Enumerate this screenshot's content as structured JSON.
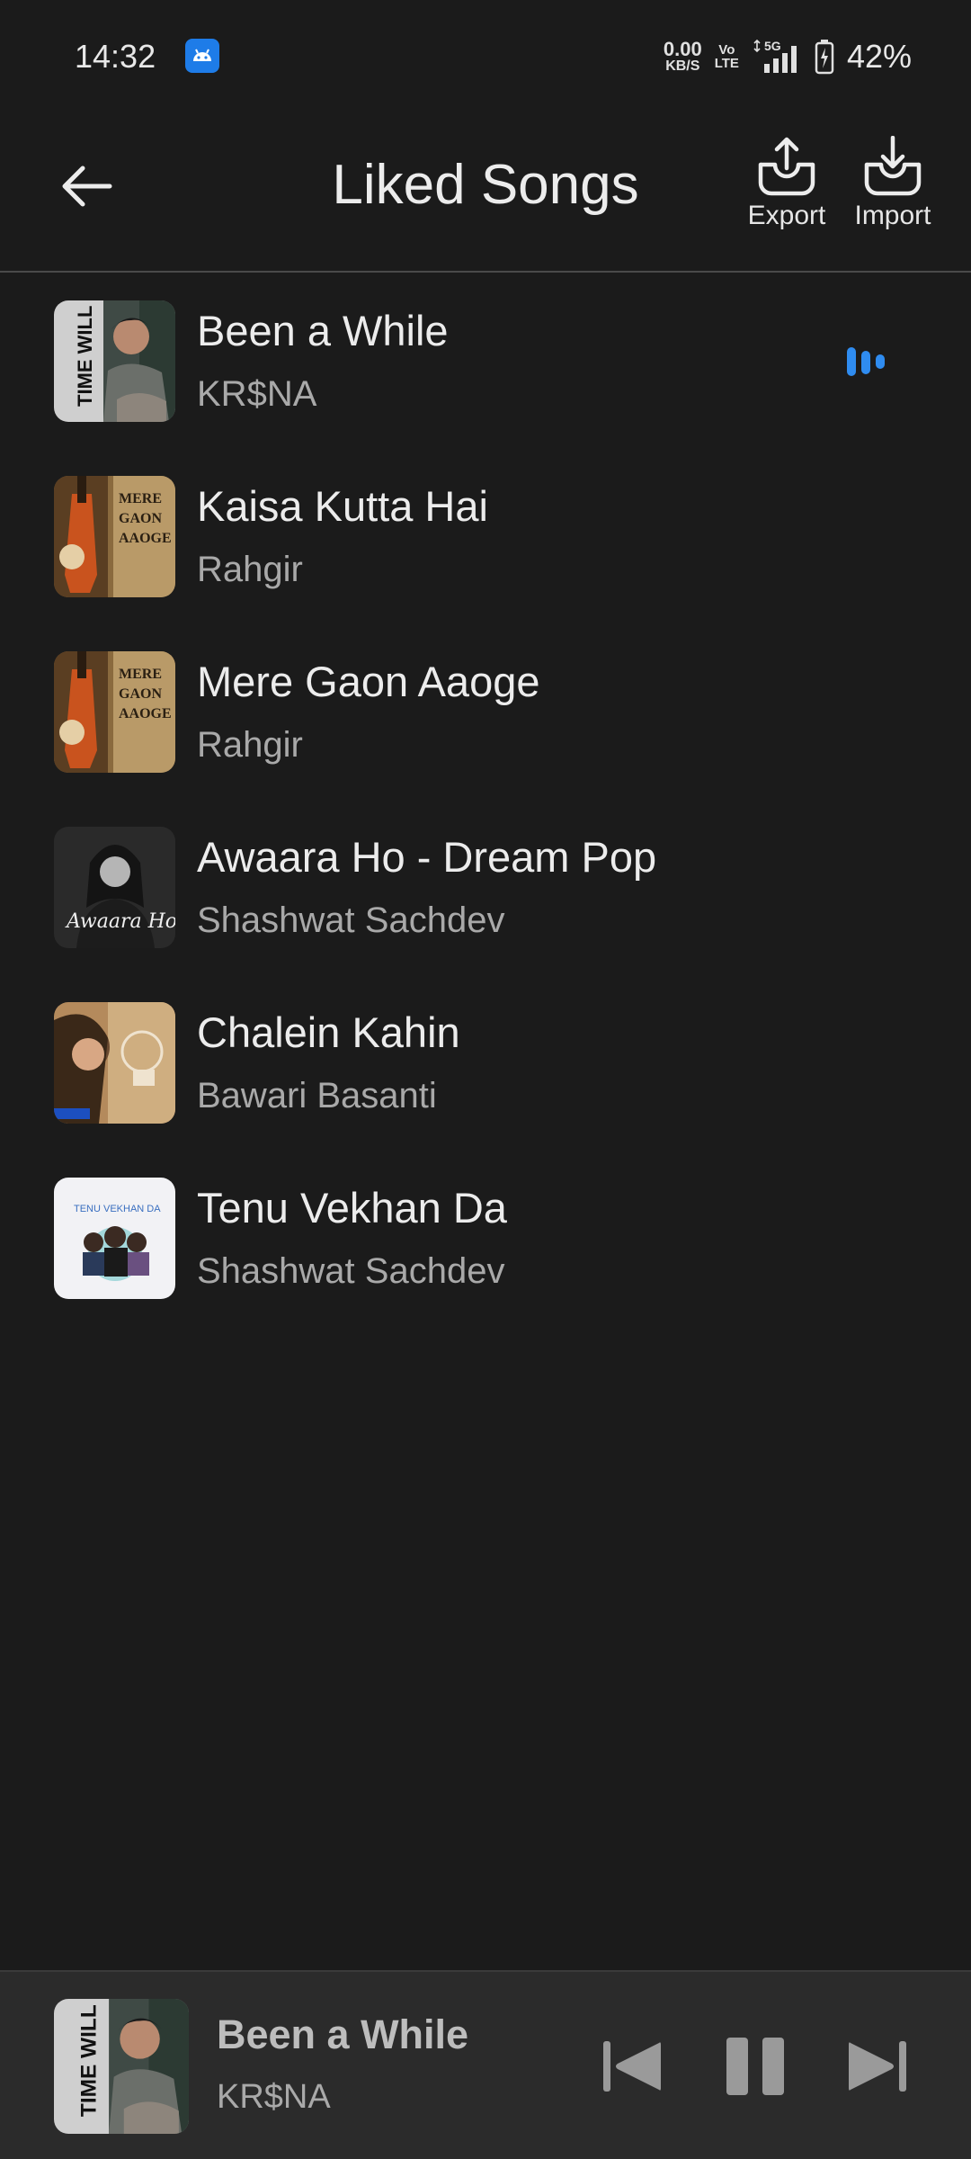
{
  "status_bar": {
    "time": "14:32",
    "net_speed_value": "0.00",
    "net_speed_unit": "KB/S",
    "volte_top": "Vo",
    "volte_bottom": "LTE",
    "network": "5G",
    "battery_percent": "42%",
    "icons": [
      "android-notification-icon",
      "signal-icon",
      "battery-icon"
    ]
  },
  "header": {
    "title": "Liked Songs",
    "export_label": "Export",
    "import_label": "Import",
    "icons": [
      "back-arrow-icon",
      "export-icon",
      "import-icon"
    ]
  },
  "songs": [
    {
      "title": "Been a While",
      "artist": "KR$NA",
      "playing": true
    },
    {
      "title": "Kaisa Kutta Hai",
      "artist": "Rahgir",
      "playing": false
    },
    {
      "title": "Mere Gaon Aaoge",
      "artist": "Rahgir",
      "playing": false
    },
    {
      "title": "Awaara Ho - Dream Pop",
      "artist": "Shashwat Sachdev",
      "playing": false
    },
    {
      "title": "Chalein Kahin",
      "artist": "Bawari Basanti",
      "playing": false
    },
    {
      "title": "Tenu Vekhan Da",
      "artist": "Shashwat Sachdev",
      "playing": false
    }
  ],
  "album_art_text": {
    "time_will_tell": "TIME WILL TELL",
    "mere_gaon": [
      "MERE",
      "GAON",
      "AAOGE"
    ],
    "awaara": "Awaara Ho",
    "tenu_top": "TENU VEKHAN DA"
  },
  "mini_player": {
    "title": "Been a While",
    "artist": "KR$NA",
    "icons": [
      "previous-icon",
      "pause-icon",
      "next-icon"
    ]
  },
  "colors": {
    "background": "#1b1b1b",
    "accent": "#2f8cf0",
    "mini_player_bg": "#2b2b2b"
  }
}
